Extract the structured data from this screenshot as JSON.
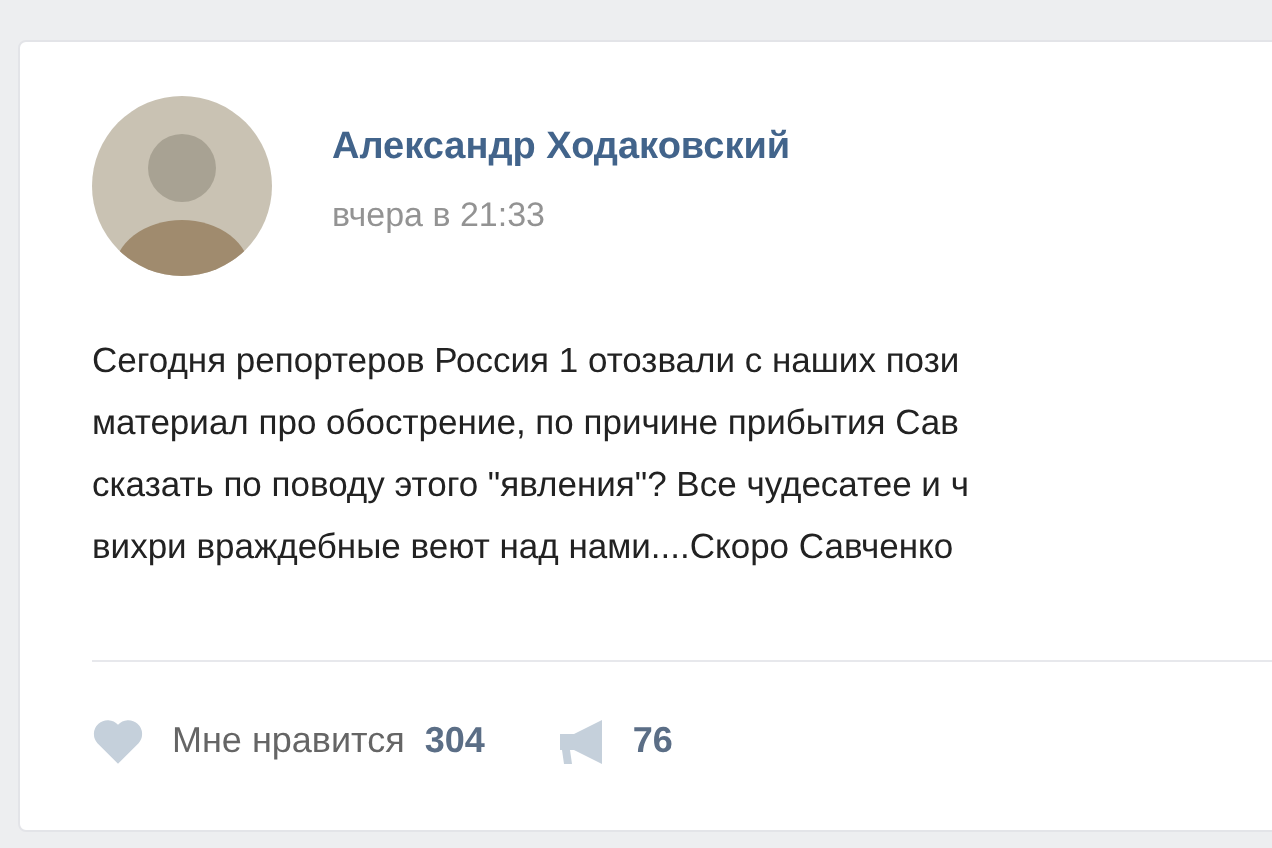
{
  "post": {
    "author": "Александр Ходаковский",
    "time": "вчера в 21:33",
    "text_lines": [
      "Сегодня репортеров Россия 1 отозвали с наших пози",
      "материал про обострение, по причине прибытия Сав",
      "сказать по поводу этого \"явления\"? Все чудесатее и ч",
      "вихри враждебные веют над нами....Скоро Савченко"
    ],
    "likes": {
      "label": "Мне нравится",
      "count": "304"
    },
    "reposts": {
      "count": "76"
    }
  }
}
